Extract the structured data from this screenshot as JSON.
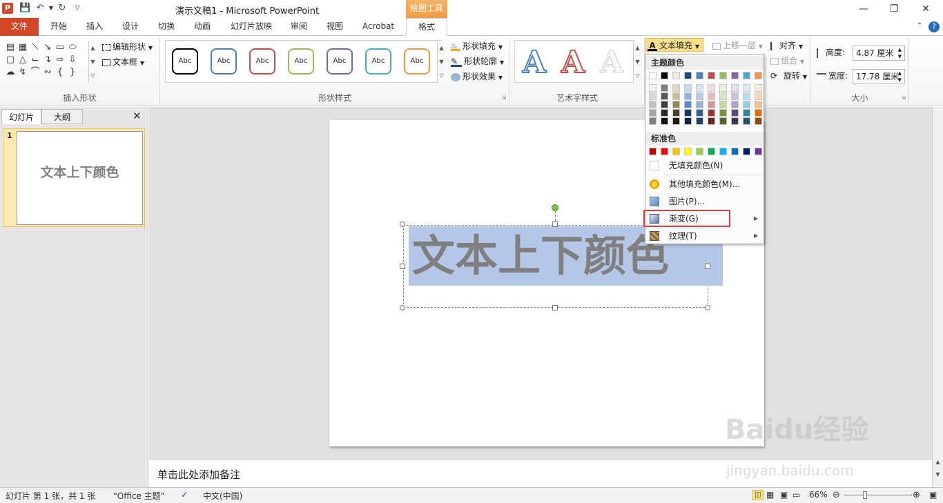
{
  "title_bar": {
    "title": "演示文稿1  -  Microsoft PowerPoint",
    "context_group": "绘图工具",
    "app_icon": "P"
  },
  "tabs": [
    {
      "label": "文件"
    },
    {
      "label": "开始"
    },
    {
      "label": "插入"
    },
    {
      "label": "设计"
    },
    {
      "label": "切换"
    },
    {
      "label": "动画"
    },
    {
      "label": "幻灯片放映"
    },
    {
      "label": "审阅"
    },
    {
      "label": "视图"
    },
    {
      "label": "Acrobat"
    },
    {
      "label": "格式"
    }
  ],
  "ribbon": {
    "insert_shapes": {
      "label": "插入形状",
      "edit_shape": "编辑形状",
      "text_box": "文本框"
    },
    "shape_styles": {
      "label": "形状样式",
      "style_label": "Abc",
      "fill": "形状填充",
      "outline": "形状轮廓",
      "effects": "形状效果",
      "style_colors": [
        "#000000",
        "#4a7ebb",
        "#c0504d",
        "#9bbb59",
        "#8064a2",
        "#4bacc6",
        "#f79646"
      ]
    },
    "art_styles": {
      "label": "艺术字样式",
      "text_fill": "文本填充",
      "art_letter": "A"
    },
    "arrange": {
      "bring_forward": "上移一层",
      "align": "对齐",
      "group": "组合",
      "rotate": "旋转"
    },
    "size": {
      "label": "大小",
      "height_label": "高度:",
      "height_value": "4.87 厘米",
      "width_label": "宽度:",
      "width_value": "17.78 厘米"
    }
  },
  "left_panel": {
    "tab_slides": "幻灯片",
    "tab_outline": "大纲",
    "slide_number": "1",
    "thumb_text": "文本上下颜色"
  },
  "slide": {
    "text": "文本上下颜色"
  },
  "notes": {
    "placeholder": "单击此处添加备注"
  },
  "status_bar": {
    "slide_info": "幻灯片 第 1 张，共 1 张",
    "theme": "“Office 主题”",
    "language": "中文(中国)",
    "zoom": "66%"
  },
  "color_menu": {
    "theme_colors_label": "主题颜色",
    "standard_colors_label": "标准色",
    "theme_row": [
      "#ffffff",
      "#000000",
      "#eeece1",
      "#1f497d",
      "#4f81bd",
      "#c0504d",
      "#9bbb59",
      "#8064a2",
      "#4bacc6",
      "#f79646"
    ],
    "theme_shades": [
      [
        "#f2f2f2",
        "#7f7f7f",
        "#ddd9c3",
        "#c6d9f0",
        "#dbe5f1",
        "#f2dcdb",
        "#ebf1dd",
        "#e5e0ec",
        "#dbeef3",
        "#fdeada"
      ],
      [
        "#d8d8d8",
        "#595959",
        "#c4bd97",
        "#8db3e2",
        "#b8cce4",
        "#e5b9b7",
        "#d7e3bc",
        "#ccc1d9",
        "#b7dde8",
        "#fbd5b5"
      ],
      [
        "#bfbfbf",
        "#3f3f3f",
        "#938953",
        "#548dd4",
        "#95b3d7",
        "#d99694",
        "#c3d69b",
        "#b2a2c7",
        "#92cddc",
        "#fac08f"
      ],
      [
        "#a5a5a5",
        "#262626",
        "#494429",
        "#17365d",
        "#366092",
        "#953734",
        "#76923c",
        "#5f497a",
        "#31859b",
        "#e36c09"
      ],
      [
        "#7f7f7f",
        "#0c0c0c",
        "#1d1b10",
        "#0f243e",
        "#244061",
        "#632423",
        "#4f6128",
        "#3f3151",
        "#205867",
        "#974806"
      ]
    ],
    "standard": [
      "#c00000",
      "#ff0000",
      "#ffc000",
      "#ffff00",
      "#92d050",
      "#00b050",
      "#00b0f0",
      "#0070c0",
      "#002060",
      "#7030a0"
    ],
    "no_fill": "无填充颜色(N)",
    "more_colors": "其他填充颜色(M)...",
    "picture": "图片(P)...",
    "gradient": "渐变(G)",
    "texture": "纹理(T)"
  },
  "watermark": {
    "main": "Baidu经验",
    "sub": "jingyan.baidu.com"
  }
}
